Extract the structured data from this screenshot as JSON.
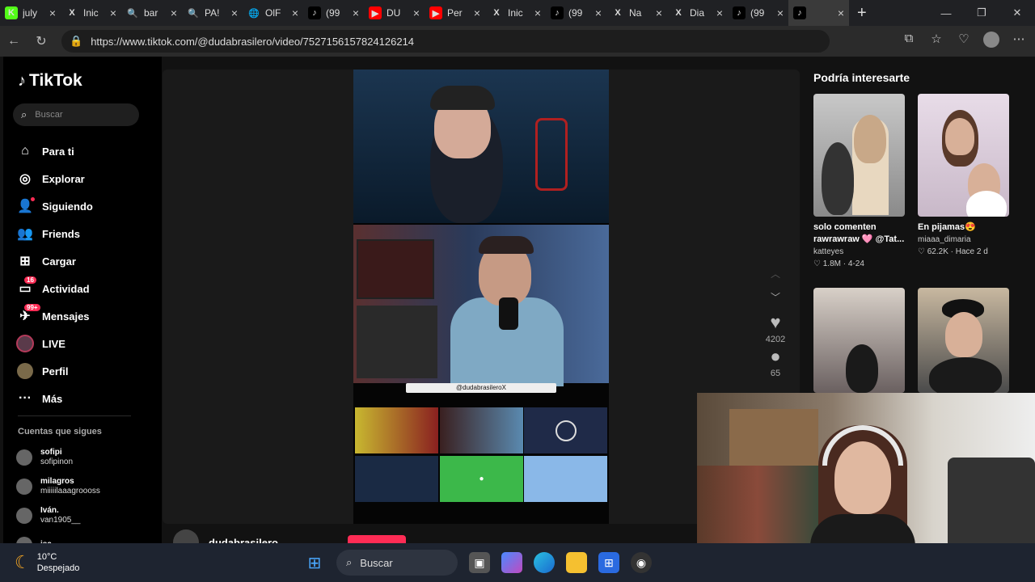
{
  "browser": {
    "tabs": [
      {
        "icon": "K",
        "icon_color": "#53fc18",
        "label": "july"
      },
      {
        "icon": "X",
        "icon_color": "#202124",
        "label": "Inic"
      },
      {
        "icon": "🔍",
        "icon_color": "#202124",
        "label": "bar"
      },
      {
        "icon": "🔍",
        "icon_color": "#202124",
        "label": "PA!"
      },
      {
        "icon": "🌐",
        "icon_color": "#202124",
        "label": "OlF"
      },
      {
        "icon": "♪",
        "icon_color": "#000000",
        "label": "(99"
      },
      {
        "icon": "▶",
        "icon_color": "#ff0000",
        "label": "DU"
      },
      {
        "icon": "▶",
        "icon_color": "#ff0000",
        "label": "Per"
      },
      {
        "icon": "X",
        "icon_color": "#202124",
        "label": "Inic"
      },
      {
        "icon": "♪",
        "icon_color": "#000000",
        "label": "(99"
      },
      {
        "icon": "X",
        "icon_color": "#202124",
        "label": "Na"
      },
      {
        "icon": "X",
        "icon_color": "#202124",
        "label": "Dia"
      },
      {
        "icon": "♪",
        "icon_color": "#000000",
        "label": "(99"
      },
      {
        "icon": "♪",
        "icon_color": "#000000",
        "label": ""
      }
    ],
    "url": "https://www.tiktok.com/@dudabrasilero/video/7527156157824126214"
  },
  "sidebar": {
    "logo": "TikTok",
    "search_placeholder": "Buscar",
    "menu": [
      {
        "label": "Para ti",
        "icon": "home-icon",
        "glyph": "⌂"
      },
      {
        "label": "Explorar",
        "icon": "compass-icon",
        "glyph": "◎"
      },
      {
        "label": "Siguiendo",
        "icon": "following-icon",
        "glyph": "👤"
      },
      {
        "label": "Friends",
        "icon": "friends-icon",
        "glyph": "👥"
      },
      {
        "label": "Cargar",
        "icon": "upload-icon",
        "glyph": "⊞"
      },
      {
        "label": "Actividad",
        "icon": "activity-icon",
        "glyph": "▭",
        "badge": "16"
      },
      {
        "label": "Mensajes",
        "icon": "messages-icon",
        "glyph": "✈",
        "badge": "99+"
      },
      {
        "label": "LIVE",
        "icon": "live-icon",
        "glyph": ""
      },
      {
        "label": "Perfil",
        "icon": "profile-icon",
        "glyph": ""
      },
      {
        "label": "Más",
        "icon": "more-icon",
        "glyph": "···"
      }
    ],
    "following_title": "Cuentas que sigues",
    "following": [
      {
        "name": "sofipi",
        "handle": "sofipinon"
      },
      {
        "name": "milagros",
        "handle": "miiiiilaaagroooss"
      },
      {
        "name": "Iván.",
        "handle": "van1905__"
      },
      {
        "name": "isa",
        "handle": ""
      }
    ]
  },
  "video": {
    "overlay_handle": "@dudabrasileroX",
    "author": "dudabrasilero",
    "likes": "4202",
    "comments": "65"
  },
  "suggestions": {
    "title": "Podría interesarte",
    "cards": [
      {
        "title": "solo comenten rawrawraw 🩷 @Tat...",
        "user": "katteyes",
        "stats": "♡ 1.8M · 4-24"
      },
      {
        "title": "En pijamas😍",
        "user": "miaaa_dimaria",
        "stats": "♡ 62.2K · Hace 2 d"
      },
      {
        "title": "",
        "user": "",
        "stats": ""
      },
      {
        "title": "",
        "user": "",
        "stats": ""
      }
    ]
  },
  "taskbar": {
    "temp": "10°C",
    "condition": "Despejado",
    "search": "Buscar"
  }
}
